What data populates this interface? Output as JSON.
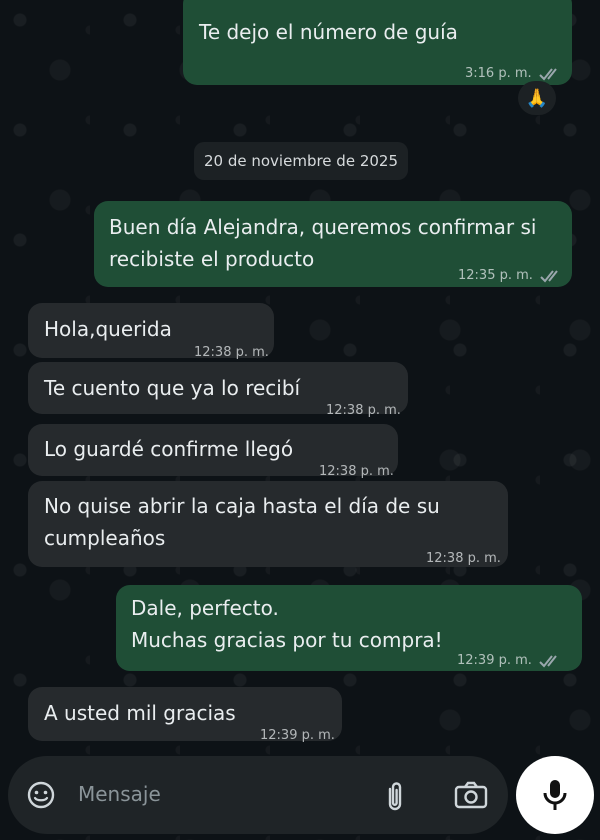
{
  "messages": [
    {
      "dir": "out",
      "lines": [
        "Te dejo el número de guía"
      ],
      "time": "3:16 p. m.",
      "read": true
    },
    {
      "dir": "out",
      "lines": [
        "Buen día Alejandra, queremos confirmar si",
        "recibiste el producto"
      ],
      "time": "12:35 p. m.",
      "read": true
    },
    {
      "dir": "in",
      "lines": [
        "Hola,querida"
      ],
      "time": "12:38 p. m."
    },
    {
      "dir": "in",
      "lines": [
        "Te cuento que ya lo recibí"
      ],
      "time": "12:38 p. m."
    },
    {
      "dir": "in",
      "lines": [
        "Lo guardé confirme llegó"
      ],
      "time": "12:38 p. m."
    },
    {
      "dir": "in",
      "lines": [
        "No quise abrir la caja hasta el día de su",
        "cumpleaños"
      ],
      "time": "12:38 p. m."
    },
    {
      "dir": "out",
      "lines": [
        "Dale, perfecto.",
        "Muchas gracias por tu compra!"
      ],
      "time": "12:39 p. m.",
      "read": true
    },
    {
      "dir": "in",
      "lines": [
        "A usted mil gracias"
      ],
      "time": "12:39 p. m."
    }
  ],
  "date_separator": "20 de noviembre de 2025",
  "reaction": "🙏",
  "composer": {
    "placeholder": "Mensaje",
    "icons": [
      "sticker-icon",
      "attach-icon",
      "camera-icon",
      "mic-icon"
    ]
  },
  "colors": {
    "outgoing_bubble": "#1f4e36",
    "incoming_bubble": "#262a2d",
    "read_ticks": "#9aa7ad"
  }
}
